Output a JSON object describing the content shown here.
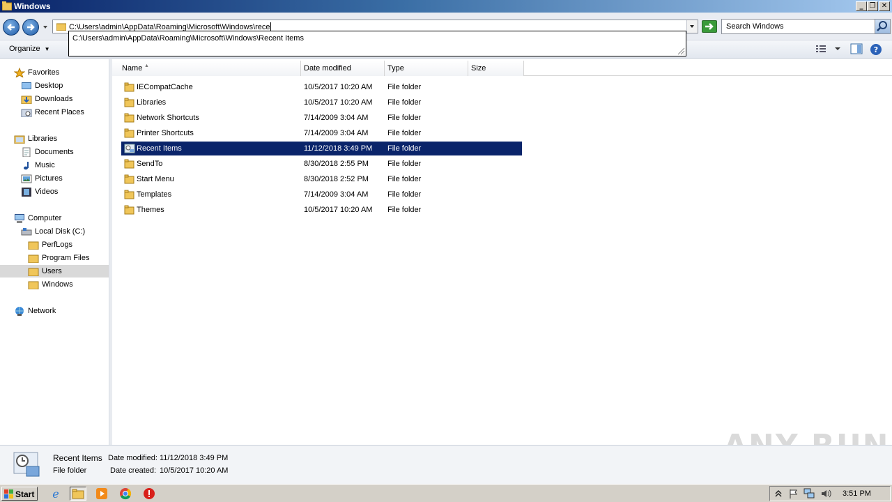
{
  "window": {
    "title": "Windows"
  },
  "address": {
    "typed": "C:\\Users\\admin\\AppData\\Roaming\\Microsoft\\Windows\\rece",
    "suggestion": "C:\\Users\\admin\\AppData\\Roaming\\Microsoft\\Windows\\Recent Items"
  },
  "search": {
    "placeholder": "Search Windows"
  },
  "toolbar": {
    "organize_label": "Organize"
  },
  "nav": {
    "favorites": "Favorites",
    "desktop": "Desktop",
    "downloads": "Downloads",
    "recent_places": "Recent Places",
    "libraries": "Libraries",
    "documents": "Documents",
    "music": "Music",
    "pictures": "Pictures",
    "videos": "Videos",
    "computer": "Computer",
    "local_disk": "Local Disk (C:)",
    "perflogs": "PerfLogs",
    "program_files": "Program Files",
    "users": "Users",
    "windows": "Windows",
    "network": "Network"
  },
  "columns": {
    "name": "Name",
    "date": "Date modified",
    "type": "Type",
    "size": "Size"
  },
  "files": [
    {
      "name": "IECompatCache",
      "date": "10/5/2017 10:20 AM",
      "type": "File folder"
    },
    {
      "name": "Libraries",
      "date": "10/5/2017 10:20 AM",
      "type": "File folder"
    },
    {
      "name": "Network Shortcuts",
      "date": "7/14/2009 3:04 AM",
      "type": "File folder"
    },
    {
      "name": "Printer Shortcuts",
      "date": "7/14/2009 3:04 AM",
      "type": "File folder"
    },
    {
      "name": "Recent Items",
      "date": "11/12/2018 3:49 PM",
      "type": "File folder"
    },
    {
      "name": "SendTo",
      "date": "8/30/2018 2:55 PM",
      "type": "File folder"
    },
    {
      "name": "Start Menu",
      "date": "8/30/2018 2:52 PM",
      "type": "File folder"
    },
    {
      "name": "Templates",
      "date": "7/14/2009 3:04 AM",
      "type": "File folder"
    },
    {
      "name": "Themes",
      "date": "10/5/2017 10:20 AM",
      "type": "File folder"
    }
  ],
  "details": {
    "name": "Recent Items",
    "type": "File folder",
    "modified_label": "Date modified:",
    "modified_value": "11/12/2018 3:49 PM",
    "created_label": "Date created:",
    "created_value": "10/5/2017 10:20 AM"
  },
  "watermark": "ANY RUN",
  "taskbar": {
    "start_label": "Start",
    "clock": "3:51 PM"
  },
  "colors": {
    "selection": "#0a246a",
    "folder": "#e8b84a"
  }
}
